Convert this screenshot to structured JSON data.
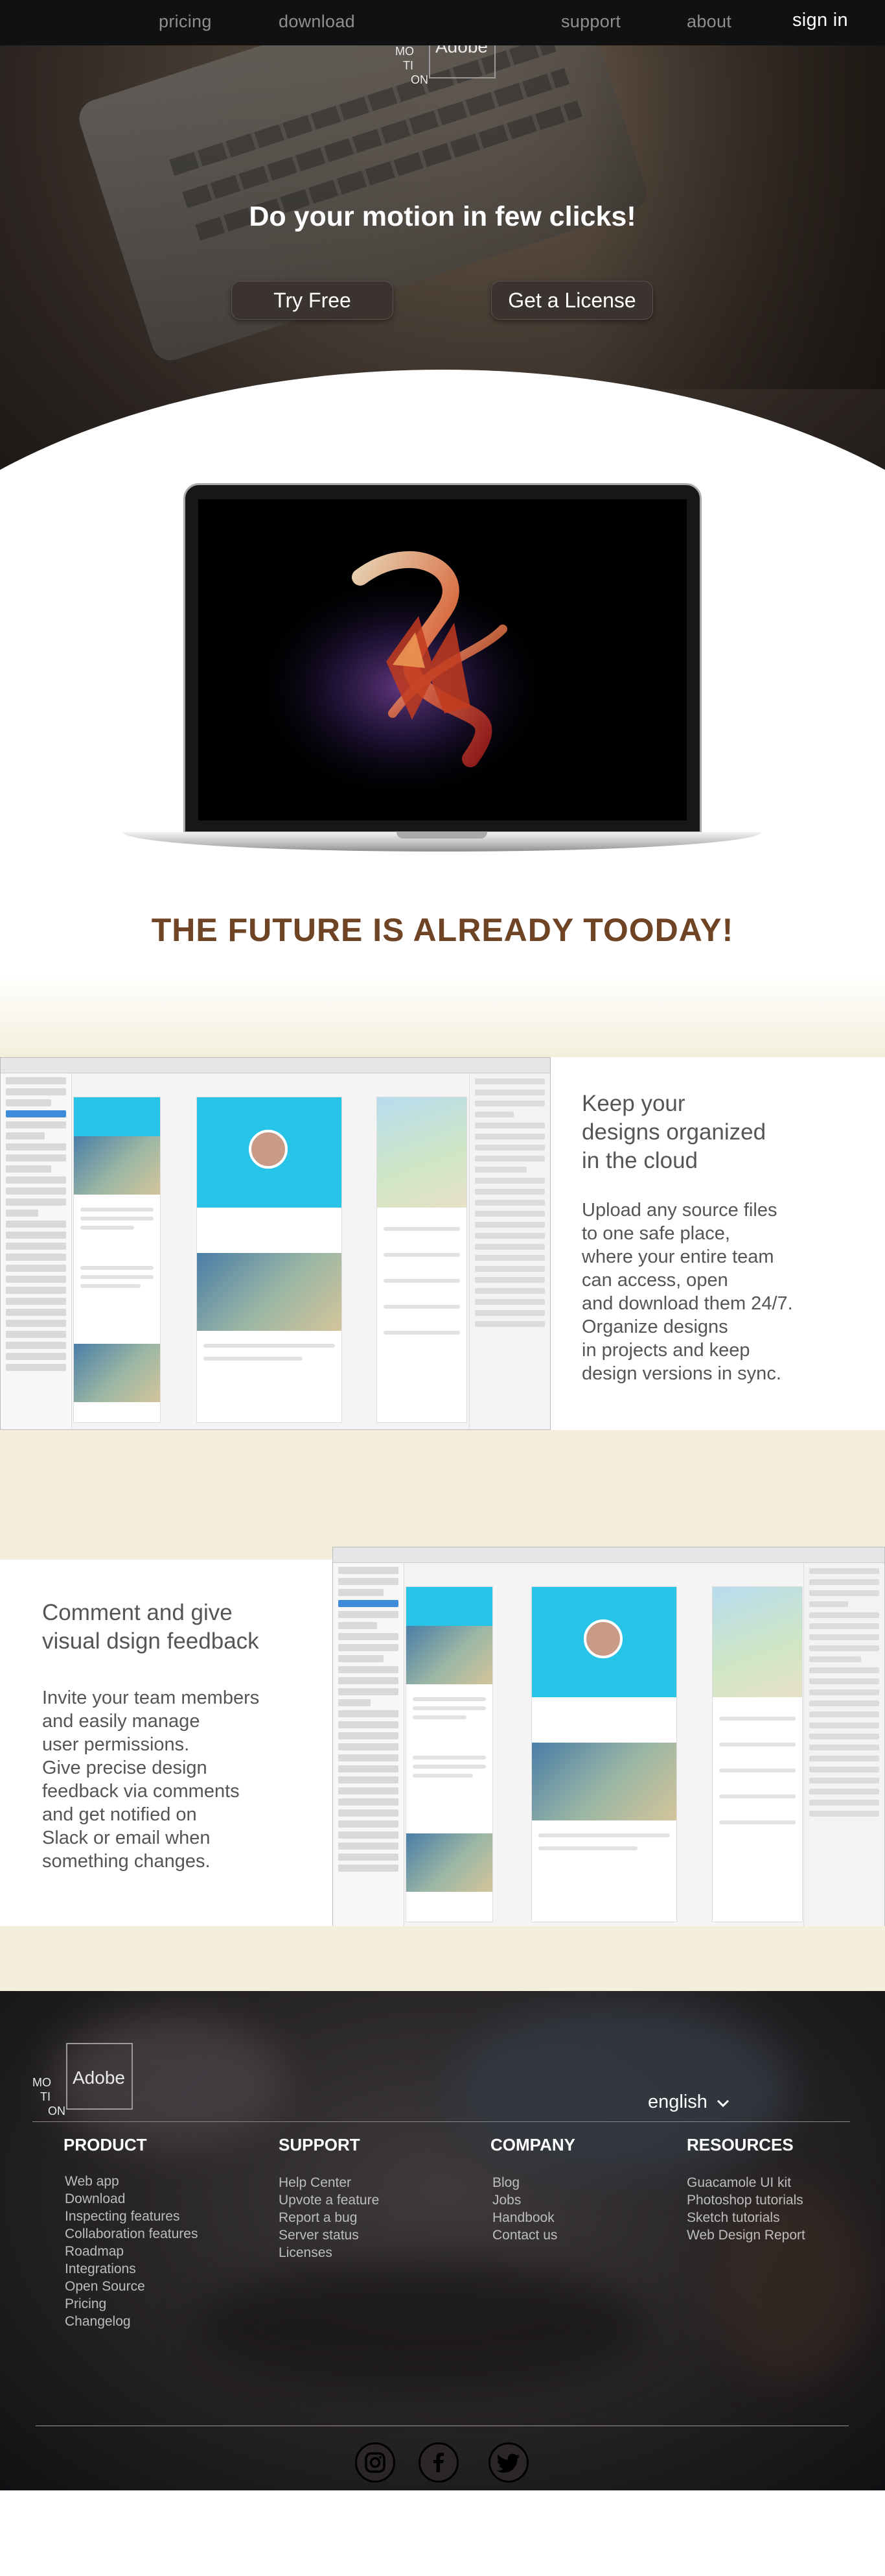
{
  "nav": {
    "pricing": "pricing",
    "download": "download",
    "support": "support",
    "about": "about",
    "signin": "sign in"
  },
  "logo": {
    "brand": "Adobe",
    "mot_lines": [
      "MO",
      "TI",
      "ON"
    ]
  },
  "hero": {
    "title": "Do your motion in few clicks!",
    "try_free": "Try Free",
    "get_license": "Get a License"
  },
  "tagline": "THE FUTURE IS ALREADY TOODAY!",
  "feature1": {
    "title_lines": [
      "Keep your",
      "designs organized",
      "in the cloud"
    ],
    "text_lines": [
      "Upload any source files",
      "to one safe place,",
      "where your entire team",
      "can access, open",
      "and download them 24/7.",
      "Organize designs",
      "in projects and keep",
      "design versions in sync."
    ]
  },
  "feature2": {
    "title_lines": [
      "Comment and give",
      "visual dsign feedback"
    ],
    "text_lines": [
      "Invite your team members",
      "and easily manage",
      "user permissions.",
      "Give precise design",
      "feedback via comments",
      "and get notified on",
      "Slack or email when",
      "something changes."
    ]
  },
  "footer": {
    "language": "english",
    "columns": [
      {
        "heading": "PRODUCT",
        "links": [
          "Web app",
          "Download",
          "Inspecting features",
          "Collaboration features",
          "Roadmap",
          "Integrations",
          "Open Source",
          "Pricing",
          "Changelog"
        ]
      },
      {
        "heading": "SUPPORT",
        "links": [
          "Help Center",
          "Upvote a feature",
          "Report a bug",
          "Server status",
          "Licenses"
        ]
      },
      {
        "heading": "COMPANY",
        "links": [
          "Blog",
          "Jobs",
          "Handbook",
          "Contact us"
        ]
      },
      {
        "heading": "RESOURCES",
        "links": [
          "Guacamole UI kit",
          "Photoshop tutorials",
          "Sketch tutorials",
          "Web Design Report"
        ]
      }
    ],
    "social": [
      "instagram-icon",
      "facebook-icon",
      "twitter-icon"
    ]
  },
  "colors": {
    "nav_bg": "#111111",
    "tagline": "#6e4424",
    "cream": "#f4efdc",
    "app_accent": "#28c4e8"
  }
}
